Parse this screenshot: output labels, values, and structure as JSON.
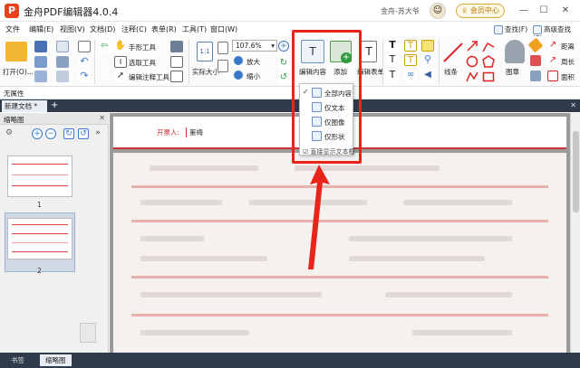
{
  "titlebar": {
    "app_title": "金舟PDF编辑器4.0.4",
    "user_name": "金舟-苏大爷",
    "vip_label": "会员中心",
    "minimize": "—",
    "maximize": "☐",
    "close": "✕"
  },
  "menu": {
    "items": [
      "文件",
      "编辑(E)",
      "视图(V)",
      "文档(D)",
      "注释(C)",
      "表单(R)",
      "工具(T)",
      "窗口(W)"
    ]
  },
  "right_tools": {
    "find": "查找(F)",
    "advanced_find": "高级查找(S)"
  },
  "ribbon": {
    "open": "打开(O)...",
    "hand_tool": "手形工具",
    "select_text": "选取工具",
    "edit_annot": "编辑注释工具",
    "actual_size": "实际大小",
    "zoom_value": "107.6%",
    "zoom_in": "放大",
    "zoom_out": "缩小",
    "edit_content": "编辑内容",
    "add": "添加",
    "edit_form": "编辑表单",
    "lines": "线条",
    "stamp": "图章",
    "distance": "距离",
    "perimeter": "周长",
    "area": "面积"
  },
  "propbar": {
    "label": "无属性"
  },
  "tabs": {
    "doc_tab": "新建文档 *",
    "add": "+",
    "close_all": "✕"
  },
  "left_panel": {
    "title": "缩略图",
    "close": "✕",
    "page_numbers": [
      "1",
      "2"
    ]
  },
  "bottom_tabs": {
    "bookmarks": "书签",
    "thumbnails": "缩略图"
  },
  "document": {
    "field_label": "开票人:",
    "field_value": "董梅"
  },
  "dropdown": {
    "items": [
      {
        "label": "全部内容",
        "checked": true
      },
      {
        "label": "仅文本",
        "checked": false
      },
      {
        "label": "仅图像",
        "checked": false
      },
      {
        "label": "仅形状",
        "checked": false
      }
    ],
    "footer": "☑ 直接显示文本框"
  },
  "colors": {
    "accent_red": "#e8241b",
    "tab_bar": "#2f3b4c",
    "brand": "#e8431d"
  }
}
